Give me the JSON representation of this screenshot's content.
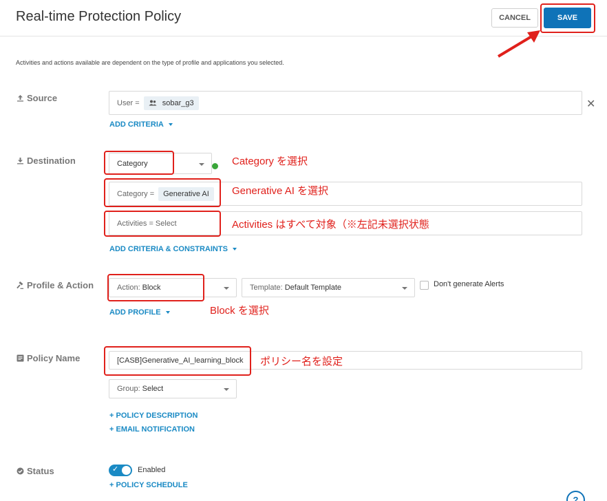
{
  "header": {
    "title": "Real-time Protection Policy",
    "cancel_label": "CANCEL",
    "save_label": "SAVE"
  },
  "note": "Activities and actions available are dependent on the type of profile and applications you selected.",
  "source": {
    "label": "Source",
    "icon": "upload-icon",
    "field_prefix": "User =",
    "chip_icon": "users-icon",
    "chip_value": "sobar_g3",
    "add_criteria": "ADD CRITERIA"
  },
  "destination": {
    "label": "Destination",
    "icon": "download-icon",
    "type_select": "Category",
    "category_prefix": "Category =",
    "category_value": "Generative AI",
    "activities": "Activities = Select",
    "add_criteria": "ADD CRITERIA & CONSTRAINTS"
  },
  "profile_action": {
    "label": "Profile & Action",
    "icon": "gavel-icon",
    "action_prefix": "Action:",
    "action_value": "Block",
    "template_prefix": "Template:",
    "template_value": "Default Template",
    "no_alerts_label": "Don't generate Alerts",
    "add_profile": "ADD PROFILE"
  },
  "policy_name": {
    "label": "Policy Name",
    "icon": "document-icon",
    "value": "[CASB]Generative_AI_learning_block",
    "group_prefix": "Group:",
    "group_value": "Select",
    "policy_description": "+ POLICY DESCRIPTION",
    "email_notification": "+ EMAIL NOTIFICATION"
  },
  "status": {
    "label": "Status",
    "icon": "check-circle-icon",
    "toggle_state": "Enabled",
    "policy_schedule": "+ POLICY SCHEDULE"
  },
  "annotations": {
    "category": "Category を選択",
    "generative_ai": "Generative AI を選択",
    "activities": "Activities はすべて対象（※左記未選択状態",
    "block": "Block を選択",
    "policy_name": "ポリシー名を設定"
  },
  "colors": {
    "accent": "#0f73b8",
    "link": "#1a8ac4",
    "annotation": "#e0201b",
    "status_dot": "#3aa63a"
  }
}
